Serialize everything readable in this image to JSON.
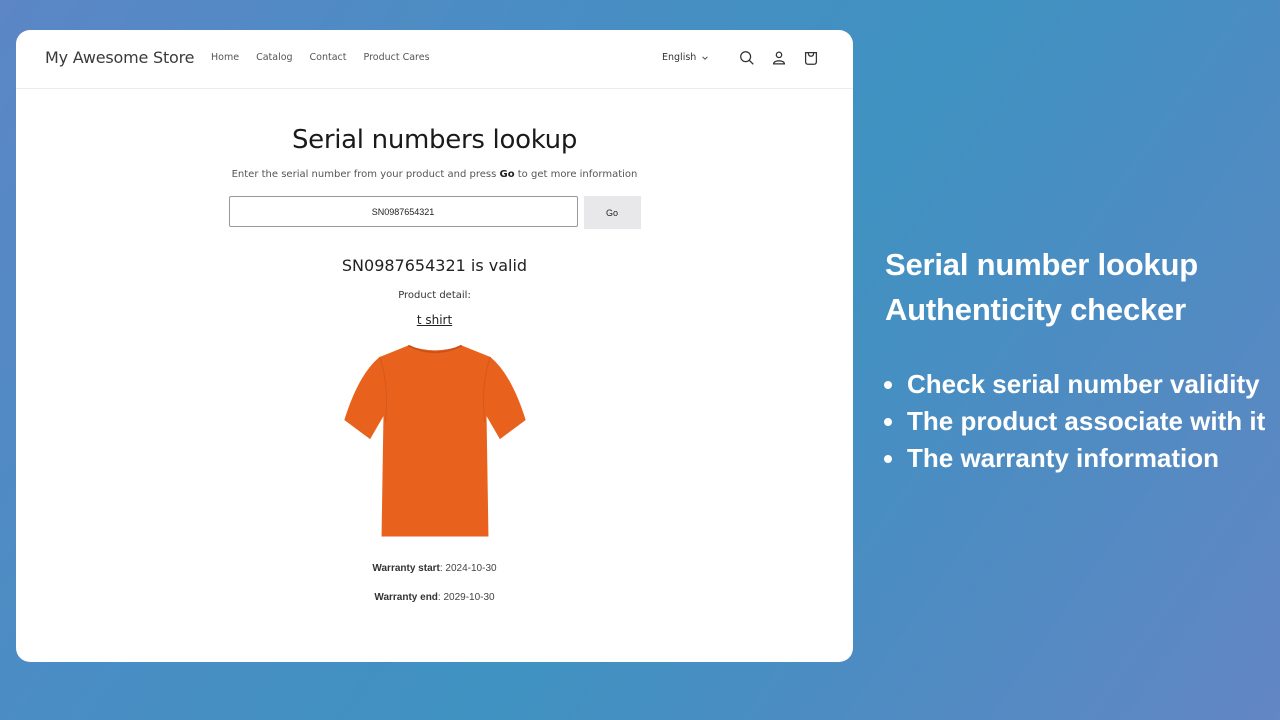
{
  "store": {
    "name": "My Awesome Store",
    "nav": [
      "Home",
      "Catalog",
      "Contact",
      "Product Cares"
    ],
    "language": "English",
    "icons": [
      "search-icon",
      "account-icon",
      "cart-icon"
    ]
  },
  "lookup": {
    "title": "Serial numbers lookup",
    "subtitle_before": "Enter the serial number from your product and press ",
    "subtitle_bold": "Go",
    "subtitle_after": " to get more information",
    "input_value": "SN0987654321",
    "go_label": "Go"
  },
  "result": {
    "status": "SN0987654321 is valid",
    "detail_label": "Product detail:",
    "product_name": "t shirt",
    "product_color": "#e8621e",
    "warranty_start_label": "Warranty start",
    "warranty_start": ": 2024-10-30",
    "warranty_end_label": "Warranty end",
    "warranty_end": ": 2029-10-30"
  },
  "promo": {
    "heading_line1": "Serial number lookup",
    "heading_line2": "Authenticity checker",
    "bullets": [
      "Check serial number validity",
      "The product associate with it",
      "The warranty information"
    ]
  }
}
